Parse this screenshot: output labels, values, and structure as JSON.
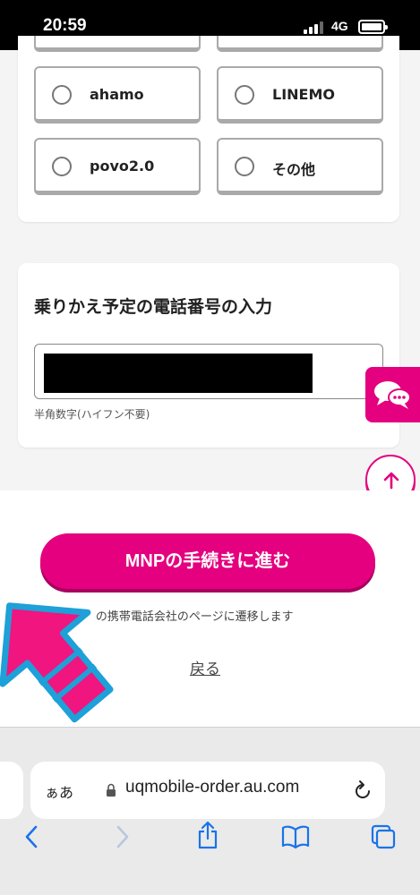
{
  "status": {
    "time": "20:59",
    "network": "4G"
  },
  "carriers": {
    "options": [
      {
        "label": "ahamo",
        "selected": false
      },
      {
        "label": "LINEMO",
        "selected": false
      },
      {
        "label": "povo2.0",
        "selected": false
      },
      {
        "label": "その他",
        "selected": false
      }
    ]
  },
  "phone": {
    "title": "乗りかえ予定の電話番号の入力",
    "hint": "半角数字(ハイフン不要)"
  },
  "actions": {
    "mnp_button": "MNPの手続きに進む",
    "note": "※　　の携帯電話会社のページに遷移します",
    "back": "戻る"
  },
  "browser": {
    "text_size": "ぁあ",
    "url": "uqmobile-order.au.com"
  },
  "colors": {
    "brand": "#e4007f",
    "arrow": "#f0157f",
    "arrow_outline": "#1ea0d8"
  },
  "icons": {
    "chat": "chat-bubbles-icon",
    "scroll_top": "arrow-up-icon",
    "lock": "lock-icon",
    "reload": "reload-icon",
    "back": "chevron-left-icon",
    "forward": "chevron-right-icon",
    "share": "share-icon",
    "bookmarks": "book-icon",
    "tabs": "tabs-icon"
  }
}
